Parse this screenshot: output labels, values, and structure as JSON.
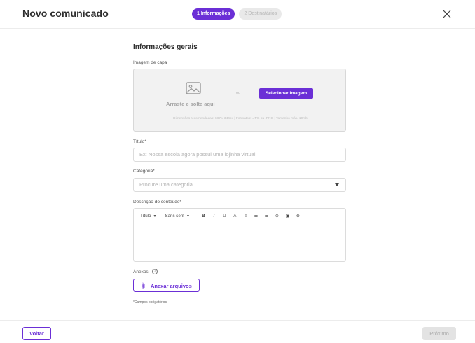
{
  "header": {
    "title": "Novo comunicado",
    "steps": [
      {
        "label": "1  Informações",
        "state": "active"
      },
      {
        "label": "2  Destinatários",
        "state": "inactive"
      }
    ],
    "close_icon": "close-icon"
  },
  "form": {
    "section_title": "Informações gerais",
    "cover": {
      "label": "Imagem de capa",
      "drop_text": "Arraste e solte aqui",
      "or_text": "ou",
      "select_button": "Selecionar imagem",
      "hint": "Dimensões recomendadas: 687 x 344px  |  Formatos: .JPG ou .PNG  |  Tamanho máx. 10mb",
      "icon": "image-icon"
    },
    "title_field": {
      "label": "Título*",
      "placeholder": "Ex: Nossa escola agora possui uma lojinha virtual",
      "value": ""
    },
    "category_field": {
      "label": "Categoria*",
      "placeholder": "Procure uma categoria",
      "value": ""
    },
    "description_field": {
      "label": "Descrição do conteúdo*",
      "toolbar": {
        "heading_dropdown": "Título",
        "font_dropdown": "Sans serif",
        "bold": "B",
        "italic": "I",
        "underline": "U",
        "text_color": "A",
        "align_center": "≡",
        "ordered_list": "☰",
        "bullet_list": "☰",
        "link": "⊖",
        "image": "▣",
        "video": "⊗"
      },
      "value": ""
    },
    "attachments": {
      "label": "Anexos",
      "help_icon": "?",
      "button": "Anexar arquivos"
    },
    "required_note": "*Campos obrigatórios"
  },
  "footer": {
    "back_button": "Voltar",
    "next_button": "Próximo"
  },
  "colors": {
    "accent": "#6b2fd6",
    "disabled_bg": "#e3e3e3",
    "dropzone_bg": "#f2f2f2"
  }
}
